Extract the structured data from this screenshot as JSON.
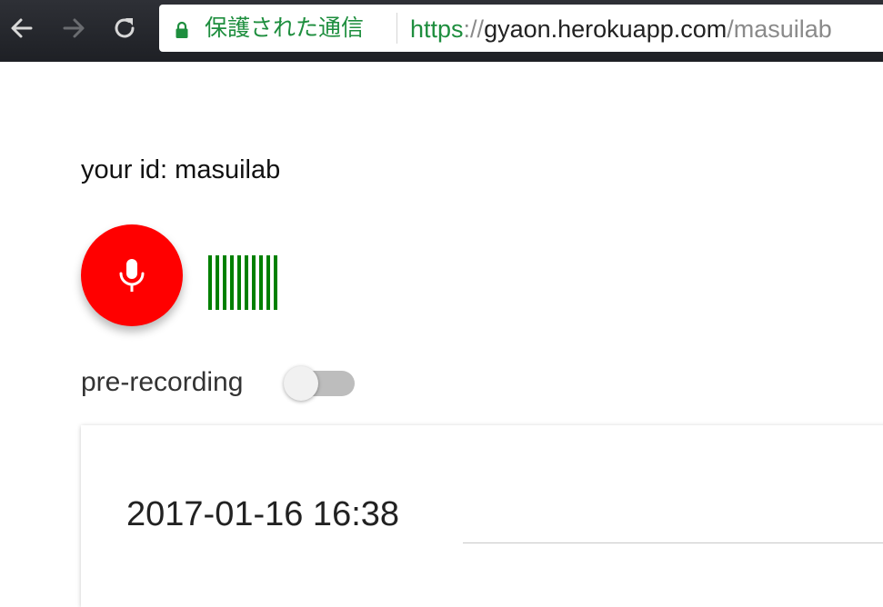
{
  "browser": {
    "back_icon": "arrow-left-icon",
    "forward_icon": "arrow-right-icon",
    "reload_icon": "reload-icon",
    "lock_icon": "lock-icon",
    "security_label": "保護された通信",
    "url": {
      "scheme": "https",
      "separator": "://",
      "host": "gyaon.herokuapp.com",
      "path": "/masuilab"
    },
    "secure_color": "#1e8e3e"
  },
  "app": {
    "user_id_text": "your id: masuilab",
    "record_button": {
      "icon": "microphone-icon",
      "color": "#ff0000"
    },
    "level_meter": {
      "bar_count": 10,
      "color": "#008000"
    },
    "pre_recording": {
      "label": "pre-recording",
      "enabled": false
    },
    "recordings": [
      {
        "timestamp": "2017-01-16 16:38"
      }
    ]
  }
}
